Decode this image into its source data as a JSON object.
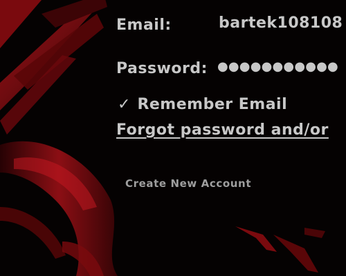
{
  "login": {
    "email_label": "Email:",
    "email_value": "bartek108108",
    "password_label": "Password:",
    "password_value": "●●●●●●●●●●●",
    "remember_checked": true,
    "remember_label": "Remember Email",
    "forgot_link": "Forgot password and/or",
    "create_account": "Create New Account"
  },
  "icons": {
    "checkmark": "check-icon"
  },
  "colors": {
    "background": "#050202",
    "accent_red": "#8a0a0a",
    "text": "#c8c8c8",
    "subtle_text": "#9e9e9e"
  }
}
